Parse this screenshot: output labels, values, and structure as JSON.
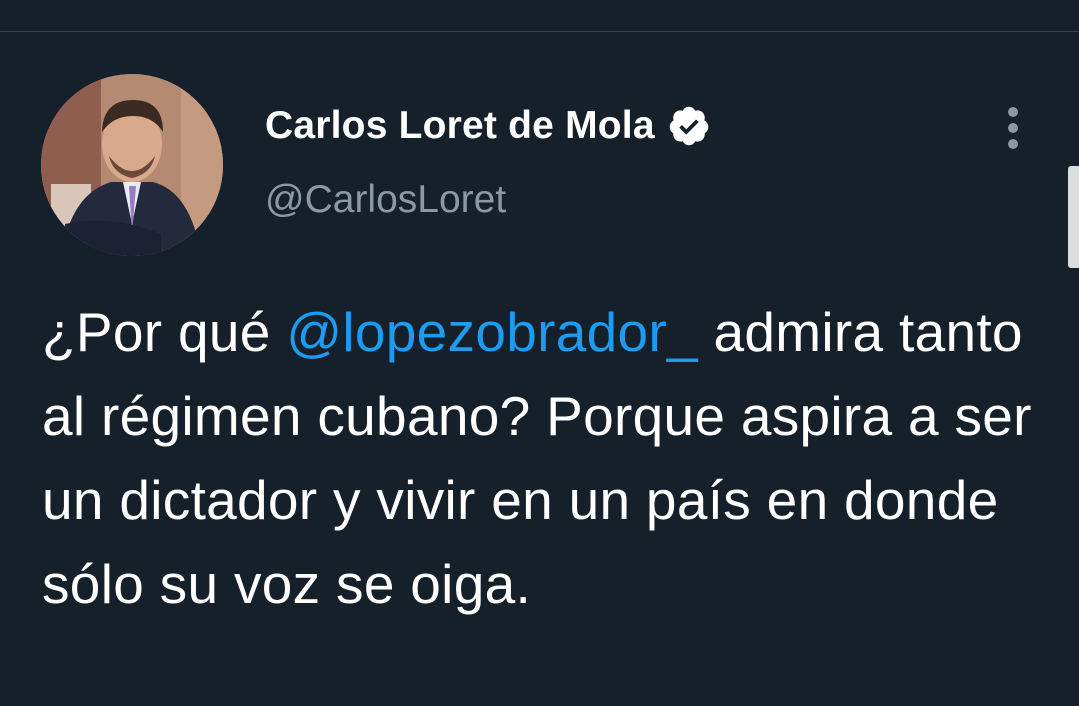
{
  "tweet": {
    "author": {
      "display_name": "Carlos Loret de Mola",
      "handle": "@CarlosLoret",
      "verified_icon": "verified-badge-icon"
    },
    "more_icon": "more-vertical-icon",
    "text_parts": {
      "before_mention": "¿Por qué ",
      "mention": "@lopezobrador_",
      "after_mention": " admira tanto al régimen cubano? Porque aspira a ser un dictador y vivir en un país en donde sólo su voz se oiga."
    }
  },
  "colors": {
    "background": "#15202b",
    "text_primary": "#ffffff",
    "text_secondary": "#8b98a5",
    "link": "#1d9bf0",
    "divider": "#38444d"
  }
}
